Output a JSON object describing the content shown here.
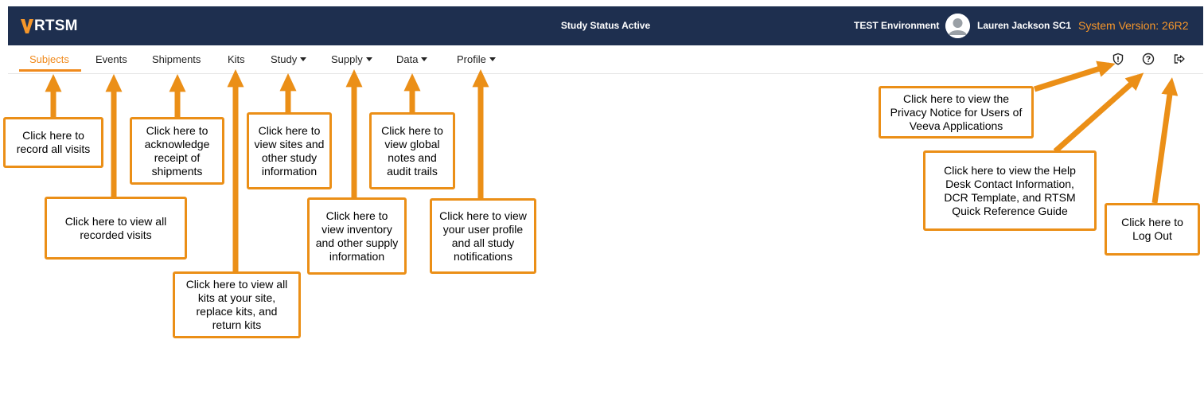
{
  "header": {
    "logo_text": "RTSM",
    "study_status": "Study Status Active",
    "environment": "TEST Environment",
    "user_name": "Lauren Jackson SC1",
    "system_version": "System Version: 26R2"
  },
  "nav": {
    "items": [
      {
        "label": "Subjects",
        "active": true,
        "dropdown": false
      },
      {
        "label": "Events",
        "active": false,
        "dropdown": false
      },
      {
        "label": "Shipments",
        "active": false,
        "dropdown": false
      },
      {
        "label": "Kits",
        "active": false,
        "dropdown": false
      },
      {
        "label": "Study",
        "active": false,
        "dropdown": true
      },
      {
        "label": "Supply",
        "active": false,
        "dropdown": true
      },
      {
        "label": "Data",
        "active": false,
        "dropdown": true
      },
      {
        "label": "Profile",
        "active": false,
        "dropdown": true
      }
    ],
    "icons": [
      "privacy-shield-icon",
      "help-question-icon",
      "logout-icon"
    ]
  },
  "callouts": {
    "subjects": "Click here to\nrecord all visits",
    "events": "Click here to view all\nrecorded visits",
    "shipments": "Click here to\nacknowledge\nreceipt of\nshipments",
    "kits": "Click here to view all\nkits at your site,\nreplace kits, and\nreturn kits",
    "study": "Click here to\nview sites and\nother study\ninformation",
    "supply": "Click here to\nview inventory\nand other supply\ninformation",
    "data": "Click here to\nview global\nnotes and\naudit trails",
    "profile": "Click here to view\nyour user profile\nand all study\nnotifications",
    "privacy": "Click here to view the\nPrivacy Notice for Users of\nVeeva Applications",
    "help": "Click here to view the Help\nDesk Contact Information,\nDCR Template, and RTSM\nQuick Reference Guide",
    "logout": "Click here to\nLog Out"
  },
  "colors": {
    "header_bg": "#1e2f4f",
    "accent_orange": "#f08a1c",
    "callout_orange": "#eb8f17",
    "version_orange": "#f5962a"
  }
}
